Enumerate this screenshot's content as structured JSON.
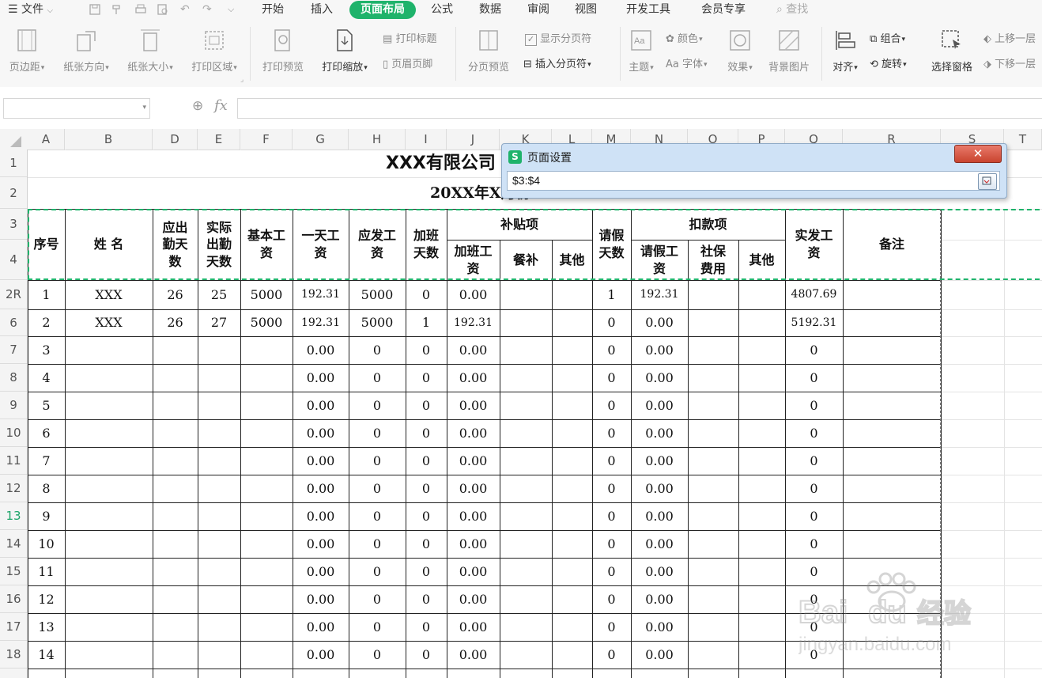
{
  "menu": {
    "file": "文件",
    "tabs": [
      "开始",
      "插入",
      "页面布局",
      "公式",
      "数据",
      "审阅",
      "视图",
      "开发工具",
      "会员专享"
    ],
    "active_tab": "页面布局",
    "search": "查找"
  },
  "ribbon": {
    "margins": "页边距",
    "orientation": "纸张方向",
    "size": "纸张大小",
    "print_area": "打印区域",
    "print_preview": "打印预览",
    "print_scale": "打印缩放",
    "print_titles": "打印标题",
    "header_footer": "页眉页脚",
    "page_break_preview": "分页预览",
    "show_page_breaks": "显示分页符",
    "insert_page_break": "插入分页符",
    "theme": "主题",
    "colors": "颜色",
    "fonts": "字体",
    "effects": "效果",
    "background": "背景图片",
    "align": "对齐",
    "group": "组合",
    "rotate": "旋转",
    "selection_pane": "选择窗格",
    "bring_forward": "上移一层",
    "send_backward": "下移一层"
  },
  "formula_bar": {
    "fx": "fx",
    "namebox": "",
    "value": ""
  },
  "columns": [
    "A",
    "B",
    "D",
    "E",
    "F",
    "G",
    "H",
    "I",
    "J",
    "K",
    "L",
    "M",
    "N",
    "O",
    "P",
    "Q",
    "R",
    "S",
    "T"
  ],
  "row_numbers": [
    "1",
    "2",
    "3",
    "4",
    "2R",
    "6",
    "7",
    "8",
    "9",
    "10",
    "11",
    "12",
    "13",
    "14",
    "15",
    "16",
    "17",
    "18"
  ],
  "selected_row": "13",
  "sheet": {
    "title": "XXX有限公司",
    "subtitle": "20XX年X月份",
    "headers": {
      "seq": "序号",
      "name": "姓    名",
      "due_days": "应出\n勤天\n数",
      "actual_days": "实际\n出勤\n天数",
      "base_wage": "基本工\n资",
      "daily_wage": "一天工\n资",
      "gross_wage": "应发工\n资",
      "ot_days": "加班\n天数",
      "allowance": "补贴项",
      "ot_pay": "加班工\n资",
      "meal": "餐补",
      "other1": "其他",
      "leave_days": "请假\n天数",
      "deduction": "扣款项",
      "leave_pay": "请假工\n资",
      "social": "社保\n费用",
      "other2": "其他",
      "net_wage": "实发工\n资",
      "remark": "备注"
    },
    "rows": [
      [
        "1",
        "XXX",
        "26",
        "25",
        "5000",
        "192.31",
        "5000",
        "0",
        "0.00",
        "",
        "",
        "1",
        "192.31",
        "",
        "",
        "4807.69",
        ""
      ],
      [
        "2",
        "XXX",
        "26",
        "27",
        "5000",
        "192.31",
        "5000",
        "1",
        "192.31",
        "",
        "",
        "0",
        "0.00",
        "",
        "",
        "5192.31",
        ""
      ],
      [
        "3",
        "",
        "",
        "",
        "",
        "0.00",
        "0",
        "0",
        "0.00",
        "",
        "",
        "0",
        "0.00",
        "",
        "",
        "0",
        ""
      ],
      [
        "4",
        "",
        "",
        "",
        "",
        "0.00",
        "0",
        "0",
        "0.00",
        "",
        "",
        "0",
        "0.00",
        "",
        "",
        "0",
        ""
      ],
      [
        "5",
        "",
        "",
        "",
        "",
        "0.00",
        "0",
        "0",
        "0.00",
        "",
        "",
        "0",
        "0.00",
        "",
        "",
        "0",
        ""
      ],
      [
        "6",
        "",
        "",
        "",
        "",
        "0.00",
        "0",
        "0",
        "0.00",
        "",
        "",
        "0",
        "0.00",
        "",
        "",
        "0",
        ""
      ],
      [
        "7",
        "",
        "",
        "",
        "",
        "0.00",
        "0",
        "0",
        "0.00",
        "",
        "",
        "0",
        "0.00",
        "",
        "",
        "0",
        ""
      ],
      [
        "8",
        "",
        "",
        "",
        "",
        "0.00",
        "0",
        "0",
        "0.00",
        "",
        "",
        "0",
        "0.00",
        "",
        "",
        "0",
        ""
      ],
      [
        "9",
        "",
        "",
        "",
        "",
        "0.00",
        "0",
        "0",
        "0.00",
        "",
        "",
        "0",
        "0.00",
        "",
        "",
        "0",
        ""
      ],
      [
        "10",
        "",
        "",
        "",
        "",
        "0.00",
        "0",
        "0",
        "0.00",
        "",
        "",
        "0",
        "0.00",
        "",
        "",
        "0",
        ""
      ],
      [
        "11",
        "",
        "",
        "",
        "",
        "0.00",
        "0",
        "0",
        "0.00",
        "",
        "",
        "0",
        "0.00",
        "",
        "",
        "0",
        ""
      ],
      [
        "12",
        "",
        "",
        "",
        "",
        "0.00",
        "0",
        "0",
        "0.00",
        "",
        "",
        "0",
        "0.00",
        "",
        "",
        "0",
        ""
      ],
      [
        "13",
        "",
        "",
        "",
        "",
        "0.00",
        "0",
        "0",
        "0.00",
        "",
        "",
        "0",
        "0.00",
        "",
        "",
        "0",
        ""
      ],
      [
        "14",
        "",
        "",
        "",
        "",
        "0.00",
        "0",
        "0",
        "0.00",
        "",
        "",
        "0",
        "0.00",
        "",
        "",
        "0",
        ""
      ]
    ]
  },
  "dialog": {
    "title": "页面设置",
    "app_icon": "S",
    "close": "✕",
    "value": "$3:$4"
  },
  "watermark": {
    "brand": "Bai du 经验",
    "url": "jingyan.baidu.com"
  },
  "colors": {
    "accent": "#1fb36b",
    "dialog_bg": "#cfe2f6",
    "close_red": "#c9442f"
  }
}
